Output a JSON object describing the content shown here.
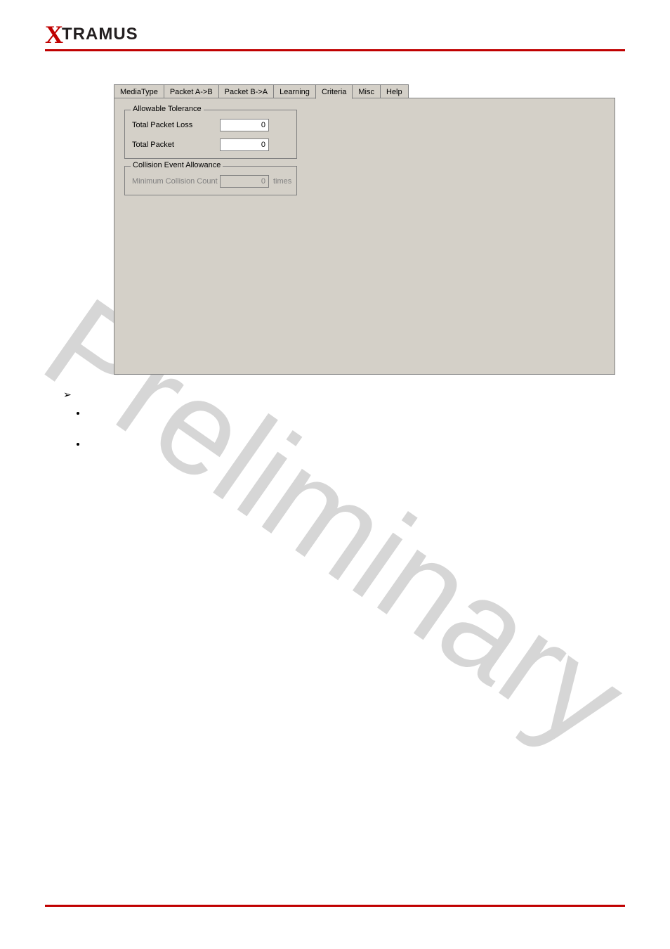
{
  "brand": {
    "x": "X",
    "rest": "TRAMUS"
  },
  "watermark": "Preliminary",
  "tabs": {
    "items": [
      {
        "label": "MediaType"
      },
      {
        "label": "Packet A->B"
      },
      {
        "label": "Packet B->A"
      },
      {
        "label": "Learning"
      },
      {
        "label": "Criteria"
      },
      {
        "label": "Misc"
      },
      {
        "label": "Help"
      }
    ],
    "selected": "Criteria"
  },
  "groups": {
    "tolerance": {
      "title": "Allowable Tolerance",
      "rows": {
        "loss": {
          "label": "Total Packet Loss",
          "value": "0"
        },
        "total": {
          "label": "Total Packet",
          "value": "0"
        }
      }
    },
    "collision": {
      "title": "Collision Event Allowance",
      "row": {
        "label": "Minimum Collision Count",
        "value": "0",
        "suffix": "times"
      }
    }
  },
  "bullets": {
    "heading": "",
    "items": [
      "",
      ""
    ]
  }
}
